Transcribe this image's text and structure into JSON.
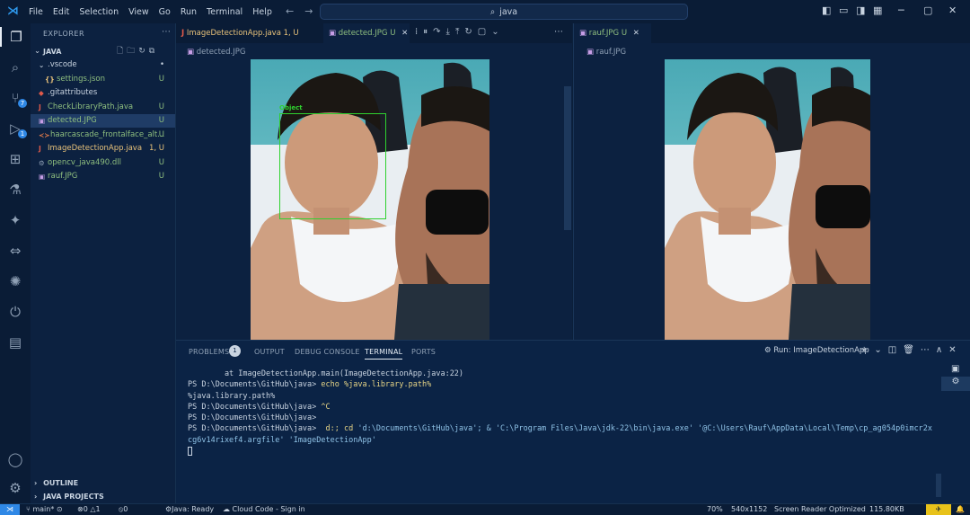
{
  "titlebar": {
    "menu": [
      "File",
      "Edit",
      "Selection",
      "View",
      "Go",
      "Run",
      "Terminal",
      "Help"
    ],
    "search_text": "java"
  },
  "sidebar": {
    "title": "EXPLORER",
    "root": "JAVA",
    "items": [
      {
        "name": ".vscode",
        "status": "•",
        "color": "#c8d3e0",
        "indent": 1,
        "icon": "chevron-down-icon"
      },
      {
        "name": "settings.json",
        "status": "U",
        "color": "#8fbf7f",
        "indent": 2,
        "icon": "json-icon"
      },
      {
        "name": ".gitattributes",
        "status": "",
        "color": "#c8d3e0",
        "indent": 1,
        "icon": "git-icon"
      },
      {
        "name": "CheckLibraryPath.java",
        "status": "U",
        "color": "#8fbf7f",
        "indent": 1,
        "icon": "java-icon"
      },
      {
        "name": "detected.JPG",
        "status": "U",
        "color": "#8fbf7f",
        "indent": 1,
        "icon": "image-icon"
      },
      {
        "name": "haarcascade_frontalface_alt...",
        "status": "U",
        "color": "#8fbf7f",
        "indent": 1,
        "icon": "xml-icon"
      },
      {
        "name": "ImageDetectionApp.java",
        "status": "1, U",
        "color": "#e8c27a",
        "indent": 1,
        "icon": "java-icon"
      },
      {
        "name": "opencv_java490.dll",
        "status": "U",
        "color": "#8fbf7f",
        "indent": 1,
        "icon": "dll-icon"
      },
      {
        "name": "rauf.JPG",
        "status": "U",
        "color": "#8fbf7f",
        "indent": 1,
        "icon": "image-icon"
      }
    ],
    "outline": "OUTLINE",
    "java_projects": "JAVA PROJECTS"
  },
  "editor1": {
    "tabs": [
      {
        "label": "ImageDetectionApp.java",
        "status": "1, U"
      },
      {
        "label": "detected.JPG",
        "status": "U"
      }
    ],
    "breadcrumb": "detected.JPG",
    "detection_label": "Object"
  },
  "editor2": {
    "tabs": [
      {
        "label": "rauf.JPG",
        "status": "U"
      }
    ],
    "breadcrumb": "rauf.JPG"
  },
  "panel": {
    "tabs": [
      "PROBLEMS",
      "OUTPUT",
      "DEBUG CONSOLE",
      "TERMINAL",
      "PORTS"
    ],
    "problems_count": "1",
    "run_label": "Run: ImageDetectionApp",
    "terminal": {
      "line1": "        at ImageDetectionApp.main(ImageDetectionApp.java:22)",
      "line2_prompt": "PS D:\\Documents\\GitHub\\java> ",
      "line2_cmd": "echo %java.library.path%",
      "line3": "%java.library.path%",
      "line4_prompt": "PS D:\\Documents\\GitHub\\java> ",
      "line4_cmd": "^C",
      "line5": "PS D:\\Documents\\GitHub\\java>",
      "line6_prompt": "PS D:\\Documents\\GitHub\\java>  ",
      "line6_cmd": "d:; cd ",
      "line6_rest": "'d:\\Documents\\GitHub\\java'; & 'C:\\Program Files\\Java\\jdk-22\\bin\\java.exe' '@C:\\Users\\Rauf\\AppData\\Local\\Temp\\cp_ag054p0imcr2x",
      "line7": "cg6v14rixef4.argfile' 'ImageDetectionApp'"
    }
  },
  "statusbar": {
    "branch": "main*",
    "errors": "0",
    "warnings": "1",
    "ports": "0",
    "java": "Java: Ready",
    "cloud": "Cloud Code - Sign in",
    "zoom": "70%",
    "dims": "540x1152",
    "screen_reader": "Screen Reader Optimized",
    "size": "115.80KB"
  }
}
